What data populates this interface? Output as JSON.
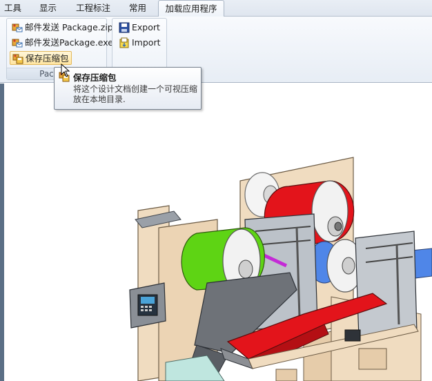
{
  "menu": {
    "tabs": [
      {
        "label": "工具"
      },
      {
        "label": "显示"
      },
      {
        "label": "工程标注"
      },
      {
        "label": "常用"
      },
      {
        "label": "加载应用程序",
        "active": true
      }
    ]
  },
  "ribbon": {
    "package_group": {
      "label": "Package",
      "items": [
        {
          "label": "邮件发送 Package.zip",
          "icon": "mail-package-icon"
        },
        {
          "label": "邮件发送Package.exe",
          "icon": "mail-package-icon"
        },
        {
          "label": "保存压缩包",
          "icon": "save-package-icon",
          "highlighted": true
        }
      ]
    },
    "io_group": {
      "items": [
        {
          "label": "Export",
          "icon": "export-icon"
        },
        {
          "label": "Import",
          "icon": "import-icon"
        }
      ]
    }
  },
  "tooltip": {
    "title": "保存压缩包",
    "description": "将这个设计文档创建一个可视压缩放在本地目录.",
    "icon": "save-package-icon"
  },
  "colors": {
    "ribbon_bg": "#e7edf5",
    "highlight": "#ffe5a0",
    "roll_red": "#e3141b",
    "roll_green": "#5ed414",
    "roll_blue": "#4f86e8",
    "frame_wood": "#f0dcc0"
  }
}
